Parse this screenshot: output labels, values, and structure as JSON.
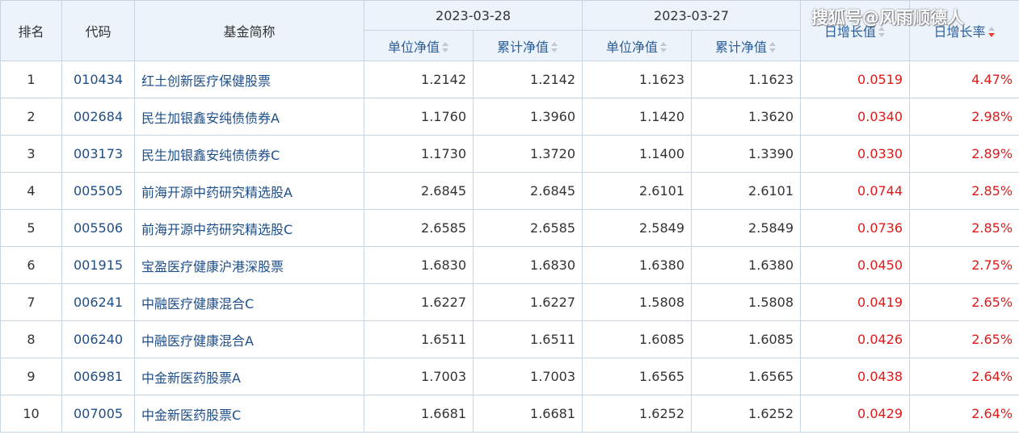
{
  "headers": {
    "rank": "排名",
    "code": "代码",
    "name": "基金简称",
    "date1": "2023-03-28",
    "date2": "2023-03-27",
    "unit_nav": "单位净值",
    "acc_nav": "累计净值",
    "daily_growth": "日增长值",
    "daily_rate": "日增长率"
  },
  "watermark": "搜狐号@风雨顺德人",
  "colors": {
    "header_bg": "#edf3fb",
    "border": "#c9d4e3",
    "link": "#1e4e87",
    "positive": "#e01818",
    "sort_active": "#e6402b"
  },
  "rows": [
    {
      "rank": "1",
      "code": "010434",
      "name": "红土创新医疗保健股票",
      "nav1": "1.2142",
      "acc1": "1.2142",
      "nav2": "1.1623",
      "acc2": "1.1623",
      "growth": "0.0519",
      "rate": "4.47%"
    },
    {
      "rank": "2",
      "code": "002684",
      "name": "民生加银鑫安纯债债券A",
      "nav1": "1.1760",
      "acc1": "1.3960",
      "nav2": "1.1420",
      "acc2": "1.3620",
      "growth": "0.0340",
      "rate": "2.98%"
    },
    {
      "rank": "3",
      "code": "003173",
      "name": "民生加银鑫安纯债债券C",
      "nav1": "1.1730",
      "acc1": "1.3720",
      "nav2": "1.1400",
      "acc2": "1.3390",
      "growth": "0.0330",
      "rate": "2.89%"
    },
    {
      "rank": "4",
      "code": "005505",
      "name": "前海开源中药研究精选股A",
      "nav1": "2.6845",
      "acc1": "2.6845",
      "nav2": "2.6101",
      "acc2": "2.6101",
      "growth": "0.0744",
      "rate": "2.85%"
    },
    {
      "rank": "5",
      "code": "005506",
      "name": "前海开源中药研究精选股C",
      "nav1": "2.6585",
      "acc1": "2.6585",
      "nav2": "2.5849",
      "acc2": "2.5849",
      "growth": "0.0736",
      "rate": "2.85%"
    },
    {
      "rank": "6",
      "code": "001915",
      "name": "宝盈医疗健康沪港深股票",
      "nav1": "1.6830",
      "acc1": "1.6830",
      "nav2": "1.6380",
      "acc2": "1.6380",
      "growth": "0.0450",
      "rate": "2.75%"
    },
    {
      "rank": "7",
      "code": "006241",
      "name": "中融医疗健康混合C",
      "nav1": "1.6227",
      "acc1": "1.6227",
      "nav2": "1.5808",
      "acc2": "1.5808",
      "growth": "0.0419",
      "rate": "2.65%"
    },
    {
      "rank": "8",
      "code": "006240",
      "name": "中融医疗健康混合A",
      "nav1": "1.6511",
      "acc1": "1.6511",
      "nav2": "1.6085",
      "acc2": "1.6085",
      "growth": "0.0426",
      "rate": "2.65%"
    },
    {
      "rank": "9",
      "code": "006981",
      "name": "中金新医药股票A",
      "nav1": "1.7003",
      "acc1": "1.7003",
      "nav2": "1.6565",
      "acc2": "1.6565",
      "growth": "0.0438",
      "rate": "2.64%"
    },
    {
      "rank": "10",
      "code": "007005",
      "name": "中金新医药股票C",
      "nav1": "1.6681",
      "acc1": "1.6681",
      "nav2": "1.6252",
      "acc2": "1.6252",
      "growth": "0.0429",
      "rate": "2.64%"
    }
  ]
}
